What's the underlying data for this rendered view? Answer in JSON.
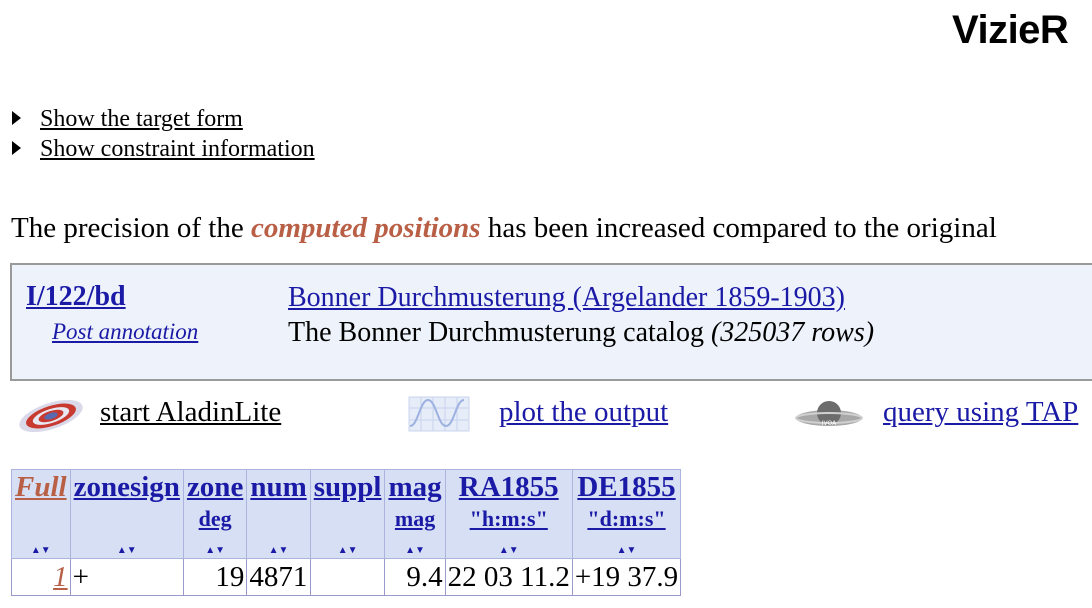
{
  "logo": "VizieR",
  "toggles": {
    "target_form": "Show the target form",
    "constraint_info": "Show constraint information"
  },
  "precision": {
    "before": "The precision of the ",
    "highlight": "computed positions",
    "after": " has been increased compared to the original"
  },
  "catalog": {
    "id": "I/122/bd",
    "post_annotation": "Post annotation",
    "title": "Bonner Durchmusterung (Argelander 1859-1903)",
    "description": "The Bonner Durchmusterung catalog",
    "rows": "(325037 rows)"
  },
  "tools": {
    "aladin": "start AladinLite",
    "plot": "plot the output ",
    "tap": "query using TAP"
  },
  "table": {
    "headers": [
      {
        "name": "Full",
        "unit": ""
      },
      {
        "name": "zonesign",
        "unit": ""
      },
      {
        "name": "zone",
        "unit": "deg"
      },
      {
        "name": "num",
        "unit": ""
      },
      {
        "name": "suppl",
        "unit": ""
      },
      {
        "name": "mag",
        "unit": "mag"
      },
      {
        "name": "RA1855",
        "unit": "\"h:m:s\""
      },
      {
        "name": "DE1855",
        "unit": "\"d:m:s\""
      }
    ],
    "rows": [
      {
        "full": "1",
        "zonesign": "+",
        "zone": "19",
        "num": "4871",
        "suppl": "",
        "mag": "9.4",
        "ra": "22 03 11.2",
        "de": "+19 37.9"
      }
    ]
  },
  "colors": {
    "link": "#1a1aa6",
    "highlight": "#b85f46",
    "box_bg": "#eef3fb",
    "header_bg": "#d6dff3"
  }
}
